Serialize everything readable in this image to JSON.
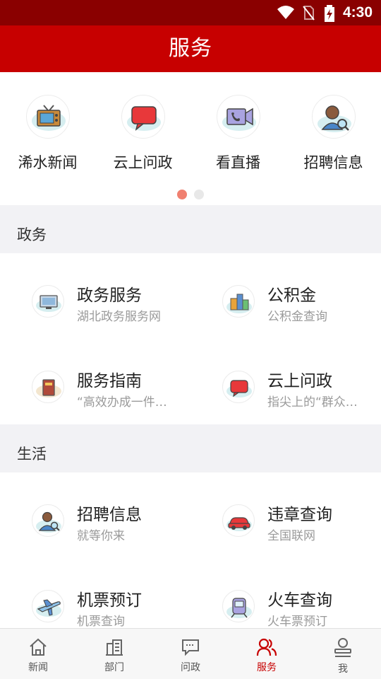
{
  "status_bar": {
    "time": "4:30",
    "icons": [
      "wifi-icon",
      "no-sim-icon",
      "battery-charging-icon"
    ]
  },
  "header": {
    "title": "服务"
  },
  "quick_links": [
    {
      "label": "浠水新闻",
      "icon": "tv-icon"
    },
    {
      "label": "云上问政",
      "icon": "speech-bubble-icon"
    },
    {
      "label": "看直播",
      "icon": "video-call-icon"
    },
    {
      "label": "招聘信息",
      "icon": "recruiter-icon"
    }
  ],
  "carousel": {
    "pages": 2,
    "active": 1
  },
  "sections": [
    {
      "title": "政务",
      "items": [
        {
          "title": "政务服务",
          "subtitle": "湖北政务服务网",
          "icon": "computer-icon"
        },
        {
          "title": "公积金",
          "subtitle": "公积金查询",
          "icon": "buildings-icon"
        },
        {
          "title": "服务指南",
          "subtitle": "“高效办成一件…",
          "icon": "book-icon"
        },
        {
          "title": "云上问政",
          "subtitle": "指尖上的“群众…",
          "icon": "speech-bubble-icon"
        }
      ]
    },
    {
      "title": "生活",
      "items": [
        {
          "title": "招聘信息",
          "subtitle": "就等你来",
          "icon": "recruiter-icon"
        },
        {
          "title": "违章查询",
          "subtitle": "全国联网",
          "icon": "car-icon"
        },
        {
          "title": "机票预订",
          "subtitle": "机票查询",
          "icon": "airplane-icon"
        },
        {
          "title": "火车查询",
          "subtitle": "火车票预订",
          "icon": "train-icon"
        }
      ]
    }
  ],
  "tab_bar": {
    "active": "服务",
    "accent": "#c70000",
    "tabs": [
      {
        "label": "新闻",
        "icon": "home-icon"
      },
      {
        "label": "部门",
        "icon": "building-icon"
      },
      {
        "label": "问政",
        "icon": "chat-icon"
      },
      {
        "label": "服务",
        "icon": "users-icon"
      },
      {
        "label": "我",
        "icon": "person-icon"
      }
    ]
  }
}
